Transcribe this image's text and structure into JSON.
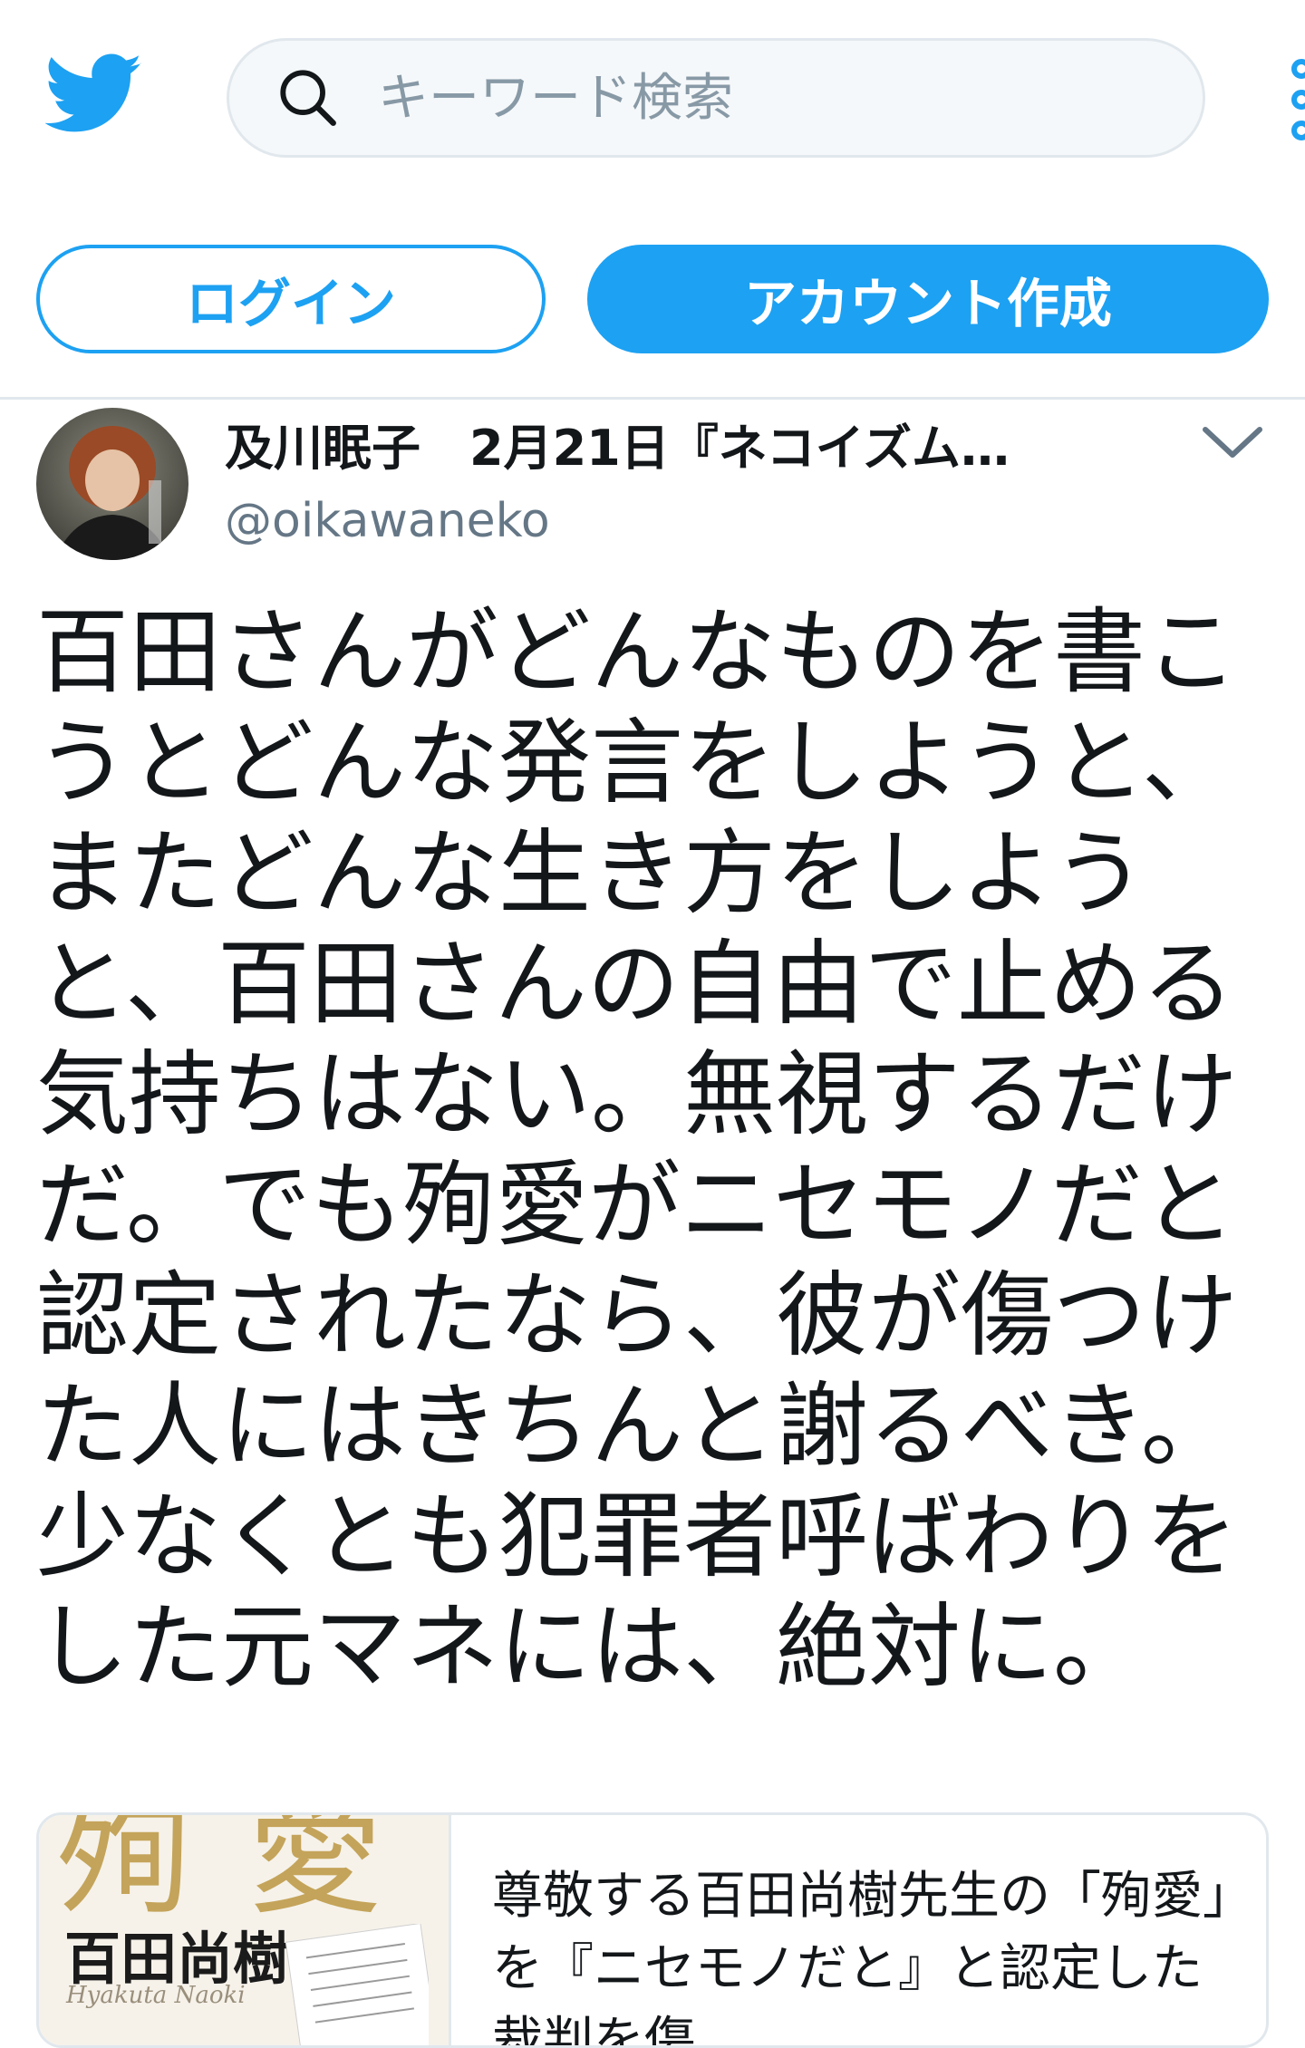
{
  "header": {
    "search_placeholder": "キーワード検索",
    "login_label": "ログイン",
    "signup_label": "アカウント作成"
  },
  "tweet": {
    "author_line": "及川眠子　2月21日『ネコイズム…",
    "handle": "@oikawaneko",
    "text": "百田さんがどんなものを書こうとどんな発言をしようと、またどんな生き方をしようと、百田さんの自由で止める気持ちはない。無視するだけだ。でも殉愛がニセモノだと認定されたなら、彼が傷つけた人にはきちんと謝るべき。少なくとも犯罪者呼ばわりをした元マネには、絶対に。"
  },
  "card": {
    "thumb_title": "殉愛",
    "thumb_author": "百田尚樹",
    "thumb_romaji": "Hyakuta Naoki",
    "text": "尊敬する百田尚樹先生の「殉愛」を『ニセモノだと』と認定した裁判を傷"
  },
  "icons": {
    "logo": "twitter-bird-icon",
    "search": "search-icon",
    "more": "more-menu-icon",
    "chevron": "chevron-down-icon"
  },
  "colors": {
    "brand": "#1da1f2",
    "text": "#14171a",
    "muted": "#657786",
    "border": "#e1e8ed"
  }
}
